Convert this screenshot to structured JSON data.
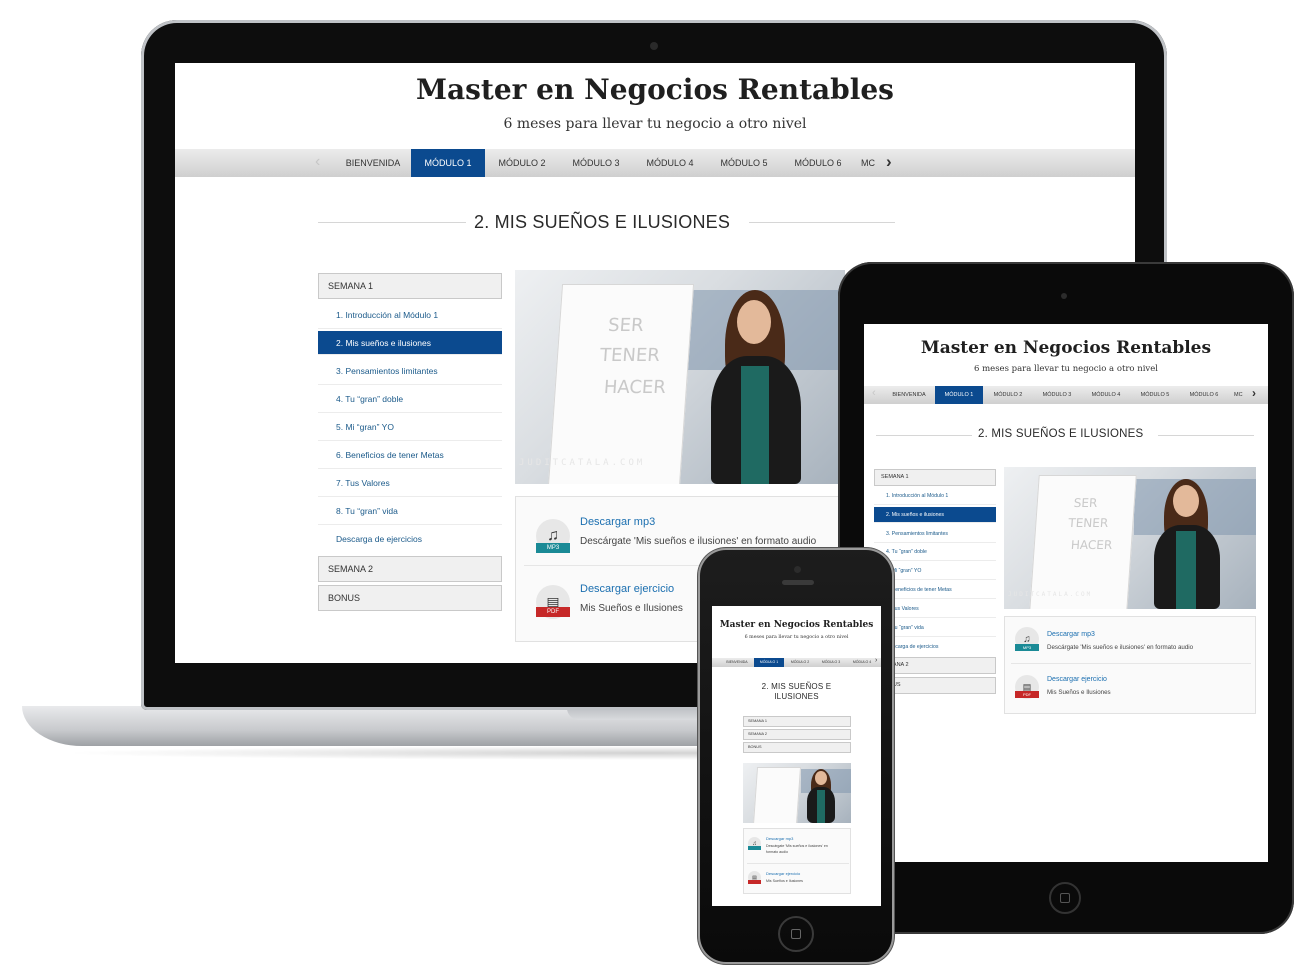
{
  "site": {
    "title": "Master en Negocios Rentables",
    "subtitle": "6 meses para llevar tu negocio a otro nivel"
  },
  "nav": {
    "prev_icon": "chevron-left-icon",
    "next_icon": "chevron-right-icon",
    "tabs": [
      "BIENVENIDA",
      "MÓDULO 1",
      "MÓDULO 2",
      "MÓDULO 3",
      "MÓDULO 4",
      "MÓDULO 5",
      "MÓDULO 6",
      "MC"
    ],
    "active_index": 1
  },
  "section": {
    "title": "2. MIS SUEÑOS E ILUSIONES",
    "title_mobile_line1": "2. MIS SUEÑOS E",
    "title_mobile_line2": "ILUSIONES"
  },
  "sidebar": {
    "week1": "SEMANA 1",
    "week2": "SEMANA 2",
    "bonus": "BONUS",
    "lessons": [
      "1. Introducción al Módulo 1",
      "2. Mis sueños e ilusiones",
      "3. Pensamientos limitantes",
      "4. Tu “gran” doble",
      "5. Mi “gran” YO",
      "6. Beneficios de tener Metas",
      "7. Tus Valores",
      "8. Tu “gran” vida",
      "Descarga de ejercicios"
    ],
    "active_index": 1
  },
  "video": {
    "board_words": [
      "SER",
      "TENER",
      "HACER"
    ],
    "watermark": "JUDITCATALA.COM"
  },
  "downloads": {
    "mp3": {
      "title": "Descargar mp3",
      "desc": "Descárgate 'Mis sueños e ilusiones' en formato audio",
      "desc_mobile_1": "Descárgate 'Mis sueños e ilusiones' en",
      "desc_mobile_2": "formato audio",
      "badge": "MP3",
      "icon": "music-note-icon"
    },
    "pdf": {
      "title": "Descargar ejercicio",
      "desc": "Mis Sueños e Ilusiones",
      "badge": "PDF",
      "icon": "document-icon"
    }
  },
  "colors": {
    "accent": "#0b4a8f",
    "link": "#1b6fb0",
    "mp3_badge": "#1a8a96",
    "pdf_badge": "#c62828"
  }
}
